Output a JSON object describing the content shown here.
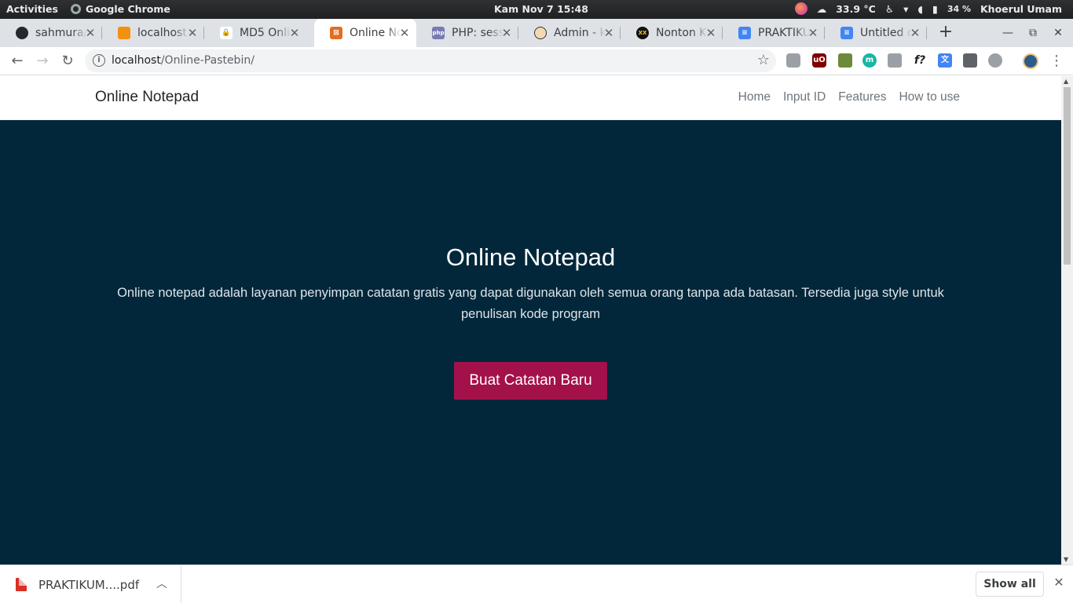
{
  "os_bar": {
    "activities": "Activities",
    "app_name": "Google Chrome",
    "clock": "Kam Nov 7  15:48",
    "temperature": "33.9 °C",
    "battery": "34 %",
    "user": "Khoerul Umam"
  },
  "tabs": [
    {
      "title": "sahmura/",
      "icon": "github-icon",
      "active": false
    },
    {
      "title": "localhost",
      "icon": "phpmyadmin-icon",
      "active": false
    },
    {
      "title": "MD5 Onli",
      "icon": "lock-icon",
      "active": false
    },
    {
      "title": "Online No",
      "icon": "xampp-icon",
      "active": true
    },
    {
      "title": "PHP: sess",
      "icon": "php-icon",
      "active": false
    },
    {
      "title": "Admin - k",
      "icon": "avatar-icon",
      "active": false
    },
    {
      "title": "Nonton K",
      "icon": "xxi-icon",
      "active": false
    },
    {
      "title": "PRAKTIKU",
      "icon": "docs-icon",
      "active": false
    },
    {
      "title": "Untitled d",
      "icon": "docs-icon",
      "active": false
    }
  ],
  "address_bar": {
    "host": "localhost",
    "path": "/Online-Pastebin/"
  },
  "site": {
    "brand": "Online Notepad",
    "nav": [
      "Home",
      "Input ID",
      "Features",
      "How to use"
    ],
    "hero_title": "Online Notepad",
    "hero_text": "Online notepad adalah layanan penyimpan catatan gratis yang dapat digunakan oleh semua orang tanpa ada batasan. Tersedia juga style untuk penulisan kode program",
    "cta": "Buat Catatan Baru"
  },
  "downloads": {
    "file": "PRAKTIKUM....pdf",
    "show_all": "Show all"
  },
  "colors": {
    "hero_bg": "#03273a",
    "cta_bg": "#a3114a",
    "active_tab_icon": "#e36d21"
  }
}
